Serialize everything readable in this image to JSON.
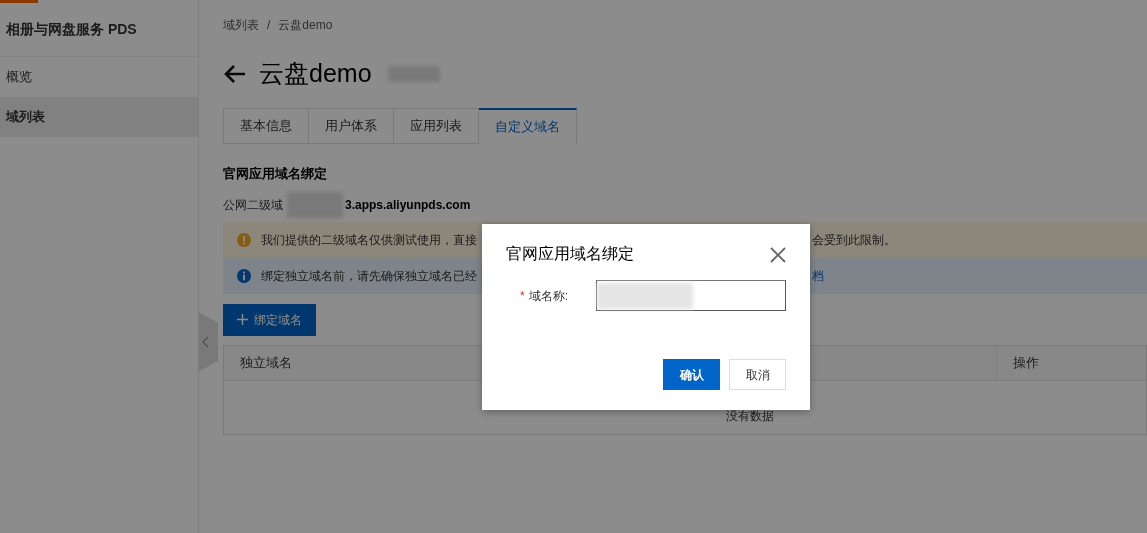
{
  "sidebar": {
    "title": "相册与网盘服务 PDS",
    "items": [
      {
        "label": "概览",
        "selected": false
      },
      {
        "label": "域列表",
        "selected": true
      }
    ]
  },
  "breadcrumb": [
    "域列表",
    "云盘demo"
  ],
  "breadcrumb_separator": "/",
  "page_title": "云盘demo",
  "tabs": [
    {
      "label": "基本信息",
      "selected": false
    },
    {
      "label": "用户体系",
      "selected": false
    },
    {
      "label": "应用列表",
      "selected": false
    },
    {
      "label": "自定义域名",
      "selected": true
    }
  ],
  "section": {
    "title": "官网应用域名绑定",
    "domain_label": "公网二级域",
    "domain_suffix": "3.apps.aliyunpds.com"
  },
  "alerts": [
    {
      "kind": "warning",
      "text_start": "我们提供的二级域名仅供测试使用，直接",
      "text_end": "会受到此限制。"
    },
    {
      "kind": "info",
      "text_start": "绑定独立域名前，请先确保独立域名已经",
      "text_end": "档"
    }
  ],
  "bind_button": "绑定域名",
  "table": {
    "columns": [
      "独立域名",
      "操作"
    ],
    "empty": "没有数据"
  },
  "dialog": {
    "title": "官网应用域名绑定",
    "field": {
      "label": "域名称:",
      "required_mark": "*"
    },
    "buttons": [
      {
        "label": "确认",
        "kind": "primary"
      },
      {
        "label": "取消",
        "kind": "secondary"
      }
    ]
  }
}
